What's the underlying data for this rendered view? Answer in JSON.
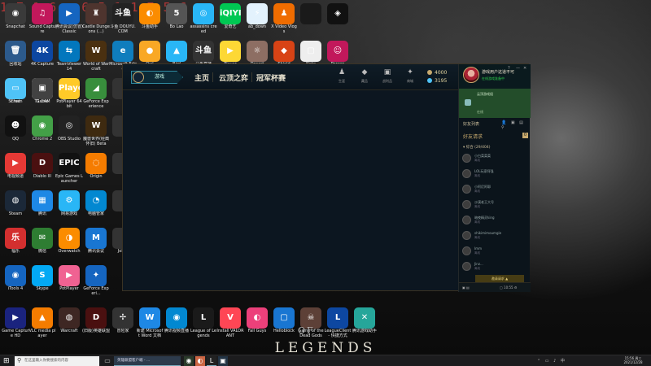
{
  "watermark": "1 7 1 6 . 6 5 1 1 7 5 6",
  "wallpaper": {
    "of_text": "OF",
    "legends_text": "LEGENDS"
  },
  "desktop_icons": [
    {
      "label": "Snapchat",
      "name": "icon-camera",
      "glyph": "◉",
      "color": "#3a3a3a"
    },
    {
      "label": "Sound Capture",
      "name": "icon-sound-capture",
      "glyph": "♫",
      "color": "#c2185b"
    },
    {
      "label": "腾讯会议(仿冒) Classic",
      "name": "icon-meeting",
      "glyph": "▶",
      "color": "#1565c0"
    },
    {
      "label": "Castle Dungeons (...)",
      "name": "icon-castle",
      "glyph": "♜",
      "color": "#4e342e"
    },
    {
      "label": "斗鱼 DOUYU.COM",
      "name": "icon-douyu",
      "glyph": "斗鱼",
      "color": "#222"
    },
    {
      "label": "斗鱼助手",
      "name": "icon-douyu-helper",
      "glyph": "◐",
      "color": "#fb8c00"
    },
    {
      "label": "Bo Lao",
      "name": "icon-bolao",
      "glyph": "5",
      "color": "#555"
    },
    {
      "label": "assassins creed",
      "name": "icon-assassin",
      "glyph": "◎",
      "color": "#29b6f6"
    },
    {
      "label": "爱奇艺",
      "name": "icon-iqiyi",
      "glyph": "iQIYI",
      "color": "#00c853"
    },
    {
      "label": "ab_down",
      "name": "icon-ab-down",
      "glyph": "⚡",
      "color": "#e3f2fd"
    },
    {
      "label": "X Video Vlogs",
      "name": "icon-xvideo",
      "glyph": "♟",
      "color": "#ef6c00"
    },
    {
      "label": "",
      "name": "icon-blank-1",
      "glyph": "",
      "color": "#1a1a1a"
    },
    {
      "label": "",
      "name": "icon-league-small",
      "glyph": "◈",
      "color": "#111"
    },
    {
      "label": "回收站",
      "name": "icon-recycle-bin",
      "glyph": "🗑",
      "color": "#2c5a8c"
    },
    {
      "label": "4K Capture",
      "name": "icon-4k-capture",
      "glyph": "4K",
      "color": "#0d47a1"
    },
    {
      "label": "TeamViewer 14",
      "name": "icon-teamviewer",
      "glyph": "⇆",
      "color": "#0277bd"
    },
    {
      "label": "World of Warcraft",
      "name": "icon-wow",
      "glyph": "W",
      "color": "#4a3010"
    },
    {
      "label": "Microsoft Edge",
      "name": "icon-edge",
      "glyph": "e",
      "color": "#0f7dbd"
    },
    {
      "label": "Owl",
      "name": "icon-owl",
      "glyph": "●",
      "color": "#f9a825"
    },
    {
      "label": "Bird",
      "name": "icon-bird",
      "glyph": "▲",
      "color": "#29b6f6"
    },
    {
      "label": "斗鱼直播",
      "name": "icon-douyu-live",
      "glyph": "斗鱼",
      "color": "#333"
    },
    {
      "label": "Player",
      "name": "icon-player",
      "glyph": "▶",
      "color": "#fdd835"
    },
    {
      "label": "Desert",
      "name": "icon-desert",
      "glyph": "☼",
      "color": "#8d6e63"
    },
    {
      "label": "Shield",
      "name": "icon-shield",
      "glyph": "◆",
      "color": "#d84315"
    },
    {
      "label": "Note",
      "name": "icon-note",
      "glyph": "▢",
      "color": "#eeeeee"
    },
    {
      "label": "Person",
      "name": "icon-person",
      "glyph": "☺",
      "color": "#c2185b"
    },
    {
      "label": "Chat",
      "name": "icon-chat",
      "glyph": "◉",
      "color": "#111"
    },
    {
      "label": "Game",
      "name": "icon-game-white",
      "glyph": "",
      "color": "#f5f5f5"
    },
    {
      "label": "Screen",
      "name": "icon-screen",
      "glyph": "▭",
      "color": "#4fc3f7"
    },
    {
      "label": "T1 CAM",
      "name": "icon-t1-cam",
      "glyph": "▣",
      "color": "#424242"
    },
    {
      "label": "PotPlayer 64 bit",
      "name": "icon-potplayer",
      "glyph": "Player",
      "color": "#ffca28"
    },
    {
      "label": "GeForce Experience",
      "name": "icon-geforce",
      "glyph": "◢",
      "color": "#388e3c"
    },
    {
      "label": "",
      "name": "icon-blank-2",
      "glyph": "",
      "color": "#333"
    },
    {
      "label": "QQ",
      "name": "icon-qq",
      "glyph": "☻",
      "color": "#111"
    },
    {
      "label": "Chrome 2",
      "name": "icon-chrome",
      "glyph": "◉",
      "color": "#43a047"
    },
    {
      "label": "OBS Studio",
      "name": "icon-obs",
      "glyph": "◎",
      "color": "#222"
    },
    {
      "label": "魔兽世界(经典怀旧) Beta",
      "name": "icon-wow-classic",
      "glyph": "W",
      "color": "#3e2a10"
    },
    {
      "label": "",
      "name": "icon-blank-3",
      "glyph": "",
      "color": "#333"
    },
    {
      "label": "电视频道",
      "name": "icon-tv",
      "glyph": "▶",
      "color": "#e53935"
    },
    {
      "label": "Diablo III",
      "name": "icon-diablo",
      "glyph": "D",
      "color": "#4a1010"
    },
    {
      "label": "Epic Games Launcher",
      "name": "icon-epic",
      "glyph": "EPIC",
      "color": "#111"
    },
    {
      "label": "Origin",
      "name": "icon-origin",
      "glyph": "◌",
      "color": "#f57c00"
    },
    {
      "label": "",
      "name": "icon-blank-4",
      "glyph": "",
      "color": "#333"
    },
    {
      "label": "Steam",
      "name": "icon-steam",
      "glyph": "◍",
      "color": "#1b2838"
    },
    {
      "label": "腾讯",
      "name": "icon-tencent",
      "glyph": "▦",
      "color": "#1e88e5"
    },
    {
      "label": "网易游戏",
      "name": "icon-netease",
      "glyph": "⚙",
      "color": "#29b6f6"
    },
    {
      "label": "电脑管家",
      "name": "icon-pc-manager",
      "glyph": "◔",
      "color": "#0288d1"
    },
    {
      "label": "",
      "name": "icon-blank-5",
      "glyph": "",
      "color": "#333"
    },
    {
      "label": "福乐",
      "name": "icon-fule",
      "glyph": "乐",
      "color": "#d32f2f"
    },
    {
      "label": "微信",
      "name": "icon-wechat",
      "glyph": "✉",
      "color": "#2e7d32"
    },
    {
      "label": "Overwatch",
      "name": "icon-overwatch",
      "glyph": "◑",
      "color": "#fb8c00"
    },
    {
      "label": "腾讯会议",
      "name": "icon-tencent-meeting",
      "glyph": "M",
      "color": "#1976d2"
    },
    {
      "label": "Joker",
      "name": "icon-joker",
      "glyph": "",
      "color": "#333"
    },
    {
      "label": "iTools 4",
      "name": "icon-itools",
      "glyph": "◉",
      "color": "#1565c0"
    },
    {
      "label": "Skype",
      "name": "icon-skype",
      "glyph": "S",
      "color": "#03a9f4"
    },
    {
      "label": "PotPlayer",
      "name": "icon-potplayer-2",
      "glyph": "▶",
      "color": "#f06292"
    },
    {
      "label": "GeForce Experi...",
      "name": "icon-geforce-2",
      "glyph": "✦",
      "color": "#1565c0"
    }
  ],
  "bottom_icons": [
    {
      "label": "Game Capture HD",
      "name": "icon-game-capture",
      "glyph": "▶",
      "color": "#1a237e"
    },
    {
      "label": "VLC media player",
      "name": "icon-vlc",
      "glyph": "▲",
      "color": "#f57c00"
    },
    {
      "label": "Warcraft",
      "name": "icon-warcraft",
      "glyph": "◍",
      "color": "#3e2723"
    },
    {
      "label": "(旧版)英雄联盟",
      "name": "icon-lol-old",
      "glyph": "D",
      "color": "#4a1010"
    },
    {
      "label": "冒险家",
      "name": "icon-adventurer",
      "glyph": "✢",
      "color": "#333"
    },
    {
      "label": "新建 Microsoft Word 文档 (2)",
      "name": "icon-word-doc",
      "glyph": "W",
      "color": "#1e88e5"
    },
    {
      "label": "腾讯视频直播",
      "name": "icon-tencent-video",
      "glyph": "◉",
      "color": "#0288d1"
    },
    {
      "label": "League of Legends",
      "name": "icon-lol",
      "glyph": "L",
      "color": "#1a1a1a"
    },
    {
      "label": "Install VALORANT",
      "name": "icon-valorant",
      "glyph": "V",
      "color": "#ff4655"
    },
    {
      "label": "Fall Guys",
      "name": "icon-fall-guys",
      "glyph": "◐",
      "color": "#ec407a"
    },
    {
      "label": "Helloblock",
      "name": "icon-helloblock",
      "glyph": "▢",
      "color": "#1976d2"
    },
    {
      "label": "Game of the Dead Gods",
      "name": "icon-dead-gods",
      "glyph": "☠",
      "color": "#5d4037"
    },
    {
      "label": "LeagueClient - 快捷方式",
      "name": "icon-league-client",
      "glyph": "L",
      "color": "#0d47a1"
    },
    {
      "label": "腾讯游戏助手",
      "name": "icon-game-assistant",
      "glyph": "✕",
      "color": "#26a69a"
    }
  ],
  "client": {
    "play_label": "游戏",
    "nav": [
      "主页",
      "云顶之弈",
      "冠军杯赛"
    ],
    "top_icons": [
      {
        "label": "生涯",
        "glyph": "♟",
        "name": "profile-icon"
      },
      {
        "label": "藏品",
        "glyph": "◆",
        "name": "collection-icon"
      },
      {
        "label": "战利品",
        "glyph": "▣",
        "name": "loot-icon"
      },
      {
        "label": "商城",
        "glyph": "✦",
        "name": "store-icon"
      }
    ],
    "currency": [
      {
        "value": "4000",
        "color": "#c8aa6e",
        "name": "blue-essence"
      },
      {
        "value": "3195",
        "color": "#4fc3f7",
        "name": "riot-points"
      }
    ]
  },
  "social": {
    "player_name": "游戏用户这道不可",
    "player_status": "在线游戏准备中",
    "controls": [
      "?",
      "—",
      "✕"
    ],
    "party_title": "云顶游戏组",
    "party_sub": "在线",
    "header": "好友列表",
    "tools": "👤 ▣ ▤ ⚲",
    "requests": "好友请求",
    "requests_count": "0",
    "group": "综合 (29/404)",
    "friends": [
      {
        "name": "小白菜菜菜",
        "status": "离线"
      },
      {
        "name": "LOL玩家阿强",
        "status": "离线"
      },
      {
        "name": "小阿尼阿耶",
        "status": "离线"
      },
      {
        "name": "沙漠老王大号",
        "status": "离线"
      },
      {
        "name": "暗夜精灵king",
        "status": "离线"
      },
      {
        "name": "shikimimoumgie",
        "status": "离线"
      },
      {
        "name": "Imm",
        "status": "离线"
      },
      {
        "name": "Jinz...",
        "status": "离线"
      }
    ],
    "invite_tab": "邀请请求 ▲",
    "bottom_left": "▣ ▤",
    "bottom_right": "▢ 10:55 ⚙"
  },
  "taskbar": {
    "search_placeholder": "在这里输入你要搜索的内容",
    "active_tab": "英雄联盟客户端 - ...",
    "tray": "⌃ ▭ ♪ 中",
    "time": "15:56 周三",
    "date": "2021/12/28"
  }
}
